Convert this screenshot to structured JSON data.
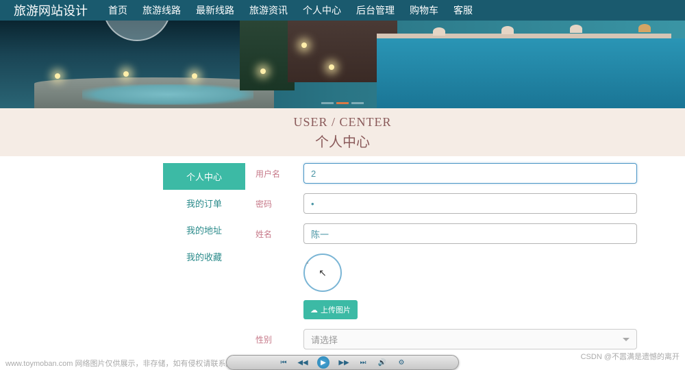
{
  "topbar": {
    "logo": "旅游网站设计",
    "nav": [
      "首页",
      "旅游线路",
      "最新线路",
      "旅游资讯",
      "个人中心",
      "后台管理",
      "购物车",
      "客服"
    ]
  },
  "title": {
    "en": "USER / CENTER",
    "cn": "个人中心"
  },
  "sidebar": {
    "items": [
      "个人中心",
      "我的订单",
      "我的地址",
      "我的收藏"
    ],
    "active_index": 0
  },
  "form": {
    "username_label": "用户名",
    "username_value": "2",
    "password_label": "密码",
    "password_value": "•",
    "name_label": "姓名",
    "name_value": "陈一",
    "upload_label": "上传图片",
    "gender_label": "性别",
    "gender_placeholder": "请选择"
  },
  "watermark": {
    "left": "www.toymoban.com 网络图片仅供展示，非存储，如有侵权请联系删除。",
    "right": "CSDN @不嚣满是遗憾的离开"
  }
}
